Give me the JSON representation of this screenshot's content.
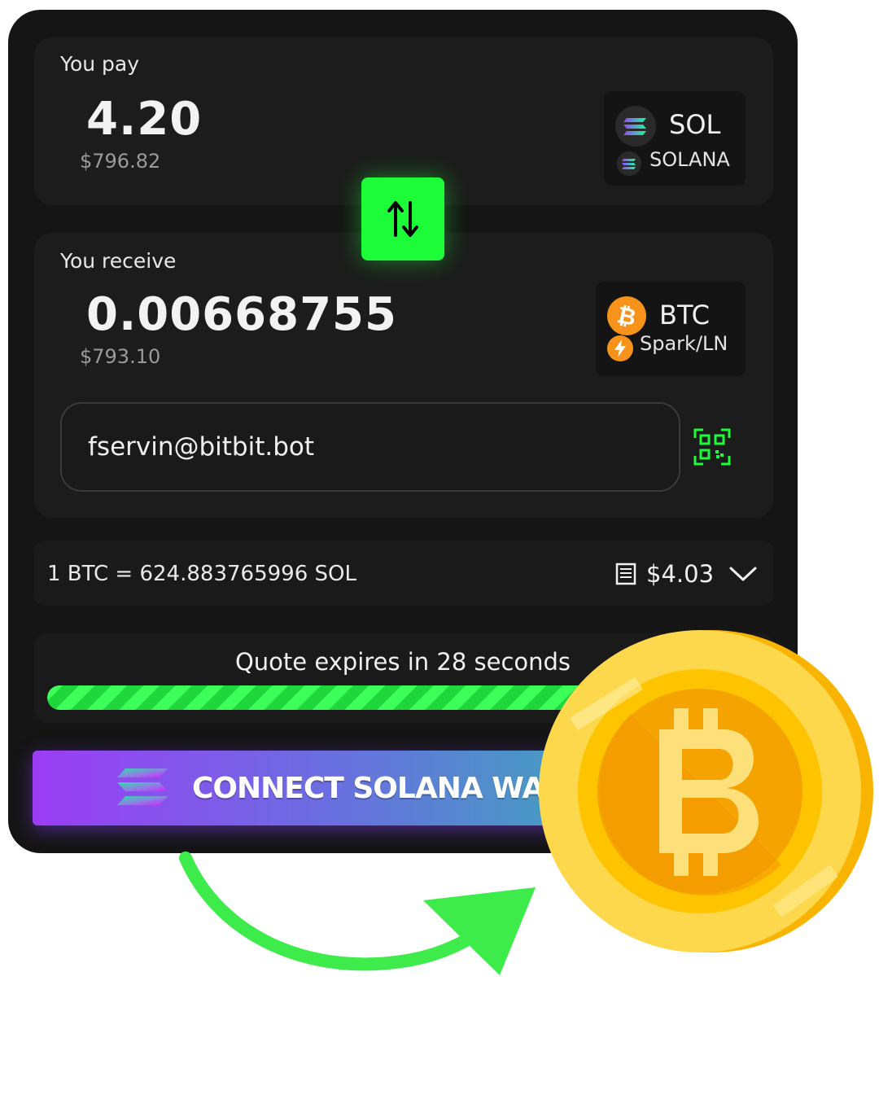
{
  "pay": {
    "label": "You pay",
    "amount": "4.20",
    "usd": "$796.82",
    "token_symbol": "SOL",
    "network": "SOLANA",
    "icon": "solana-icon"
  },
  "swap": {
    "icon": "swap-arrows-icon"
  },
  "receive": {
    "label": "You receive",
    "amount": "0.00668755",
    "usd": "$793.10",
    "token_symbol": "BTC",
    "network": "Spark/LN",
    "icon": "bitcoin-icon",
    "network_icon": "lightning-icon"
  },
  "address": {
    "value": "fservin@bitbit.bot",
    "qr_icon": "qr-scan-icon"
  },
  "rate": {
    "text": "1 BTC = 624.883765996 SOL",
    "fee": "$4.03",
    "fee_icon": "receipt-icon",
    "expand_icon": "chevron-down-icon"
  },
  "quote": {
    "text": "Quote expires in 28 seconds",
    "progress": 0.8
  },
  "connect": {
    "label": "CONNECT SOLANA WA"
  },
  "colors": {
    "accent_green": "#1dfc39",
    "card_bg": "#151515",
    "btc_orange": "#f7931a",
    "coin_gold": "#fdc700"
  },
  "decor": {
    "arrow": "green-curved-arrow-icon",
    "coin": "bitcoin-coin-icon"
  }
}
